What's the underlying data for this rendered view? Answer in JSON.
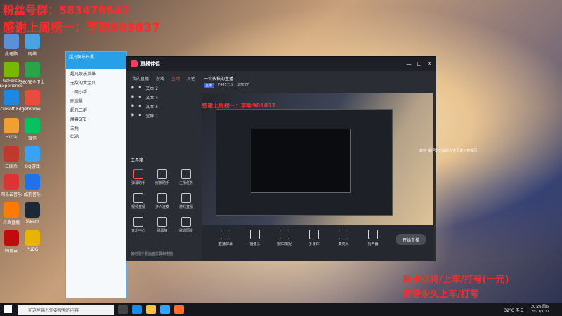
{
  "overlay": {
    "line1": "粉丝号群：583476642",
    "line2": "感谢上周榜一：李聪989837"
  },
  "desktop_icons": [
    {
      "label": "此电脑",
      "icon": "computer-icon"
    },
    {
      "label": "网络",
      "icon": "network-icon"
    },
    {
      "label": "GeForce Experience",
      "icon": "nvidia-icon"
    },
    {
      "label": "360安全卫士",
      "icon": "shield-icon"
    },
    {
      "label": "Microsoft Edge",
      "icon": "edge-icon"
    },
    {
      "label": "Chrome",
      "icon": "chrome-icon"
    },
    {
      "label": "HUYA",
      "icon": "huya-icon"
    },
    {
      "label": "微信",
      "icon": "wechat-icon"
    },
    {
      "label": "三国杀",
      "icon": "game-icon"
    },
    {
      "label": "QQ游戏",
      "icon": "qq-icon"
    },
    {
      "label": "网易云音乐",
      "icon": "music-icon"
    },
    {
      "label": "酷狗音乐",
      "icon": "kugou-icon"
    },
    {
      "label": "斗鱼直播",
      "icon": "douyu-icon"
    },
    {
      "label": "Steam",
      "icon": "steam-icon"
    },
    {
      "label": "网易云",
      "icon": "netease-icon"
    },
    {
      "label": "PUBG",
      "icon": "pubg-icon"
    }
  ],
  "qq_window": {
    "title": "超凡娱乐开黑",
    "groups": [
      "超凡娱乐英雄",
      "无敌的大宝贝",
      "上周小帮",
      "刷流量",
      "超凡二群",
      "魔兽5FB",
      "三角",
      "CSR"
    ]
  },
  "live_window": {
    "app_name": "直播伴侣",
    "tabs": [
      "我的直播",
      "游戏",
      "互动",
      "其他"
    ],
    "room_title": "一个头秩的主播",
    "room_badge": "直播",
    "room_number": "7445719",
    "viewer_count": "27077",
    "scenes": [
      "文本 2",
      "文本 4",
      "文本 5",
      "全屏 1"
    ],
    "tools_title": "工具箱",
    "tools": [
      "弹幕助手",
      "房管助手",
      "主播任务",
      "视频直播",
      "多人连麦",
      "游戏直播",
      "音乐中心",
      "弹幕墙",
      "歌词同步"
    ],
    "notice": "如何把手机画面投屏到电脑",
    "bottom_bar": [
      "直播屏幕",
      "摄像头",
      "窗口捕捉",
      "多媒体",
      "麦克风",
      "扬声器"
    ],
    "start_label": "开始直播"
  },
  "wallpaper_text": {
    "line1": "两卡点将/上车/打号(一元)",
    "line2": "房管永久上车/打号"
  },
  "chat_line": "欢迎 [新号] 无敌的大宝贝进入直播间",
  "taskbar": {
    "search_placeholder": "在这里输入你要搜索的内容",
    "weather": "32°C 多云",
    "time": "20:26 周四",
    "date": "2021/7/11"
  },
  "accent_red": "#ff2a2a"
}
